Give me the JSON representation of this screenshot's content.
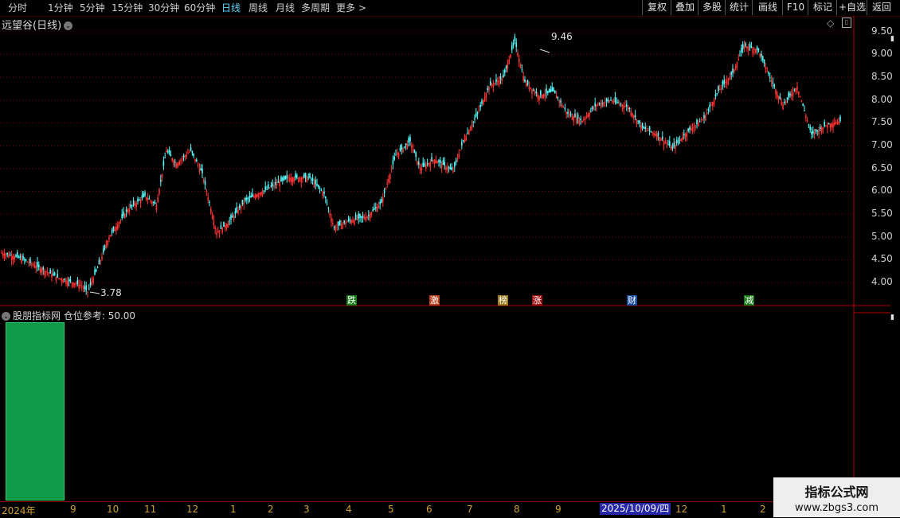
{
  "toolbar": {
    "periods": [
      "分时",
      "1分钟",
      "5分钟",
      "15分钟",
      "30分钟",
      "60分钟",
      "日线",
      "周线",
      "月线",
      "多周期",
      "更多"
    ],
    "active_period": "日线",
    "right_buttons": [
      "复权",
      "叠加",
      "多股",
      "统计",
      "画线",
      "F10",
      "标记",
      "+自选",
      "返回"
    ]
  },
  "main": {
    "stock_name": "远望谷(日线)",
    "price_axis": [
      "9.50",
      "9.00",
      "8.50",
      "8.00",
      "7.50",
      "7.00",
      "6.50",
      "6.00",
      "5.50",
      "5.00",
      "4.50",
      "4.00"
    ],
    "high_label": "9.46",
    "low_label": "3.78",
    "events": [
      "跌",
      "激",
      "榜",
      "涨",
      "财",
      "减"
    ]
  },
  "sub": {
    "indicator_name": "股朋指标网",
    "metric_label": "仓位参考: 50.00",
    "position_value": 50.0
  },
  "date_axis": {
    "labels": [
      "2024年",
      "9",
      "10",
      "11",
      "12",
      "1",
      "2",
      "3",
      "4",
      "5",
      "6",
      "7",
      "8",
      "9",
      "2025/10/09/四",
      "12",
      "1",
      "2"
    ]
  },
  "watermark": {
    "line1": "指标公式网",
    "line2": "www.zbgs3.com"
  },
  "colors": {
    "up": "#ff3333",
    "down": "#54fcfc",
    "grid": "#7a0000",
    "volume_bar": "#0f9a48",
    "active_period": "#5fd7ff"
  }
}
